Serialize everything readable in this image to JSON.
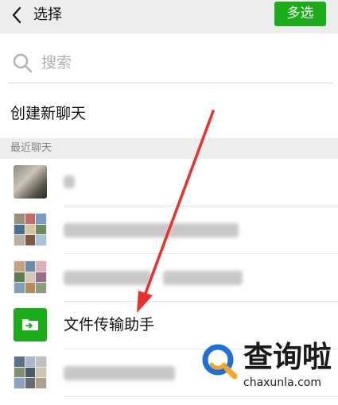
{
  "header": {
    "title": "选择",
    "multi_select_label": "多选",
    "back_icon": "back-chevron-icon"
  },
  "search": {
    "placeholder": "搜索",
    "icon": "search-icon"
  },
  "new_chat": {
    "label": "创建新聊天"
  },
  "recent": {
    "section_label": "最近聊天",
    "chats": [
      {
        "name": "",
        "blurred": true
      },
      {
        "name": "",
        "blurred": true
      },
      {
        "name": "",
        "blurred": true
      },
      {
        "name": "文件传输助手",
        "blurred": false,
        "icon": "folder-transfer-icon"
      },
      {
        "name": "",
        "blurred": true
      }
    ]
  },
  "watermark": {
    "brand": "查询啦",
    "url": "chaxunla.com"
  },
  "annotation": {
    "icon": "red-arrow-icon"
  },
  "colors": {
    "accent": "#1aad19",
    "header_bg": "#ededed",
    "arrow": "#e8302d",
    "watermark_blue": "#1e6fd9",
    "watermark_orange": "#f5a623"
  }
}
